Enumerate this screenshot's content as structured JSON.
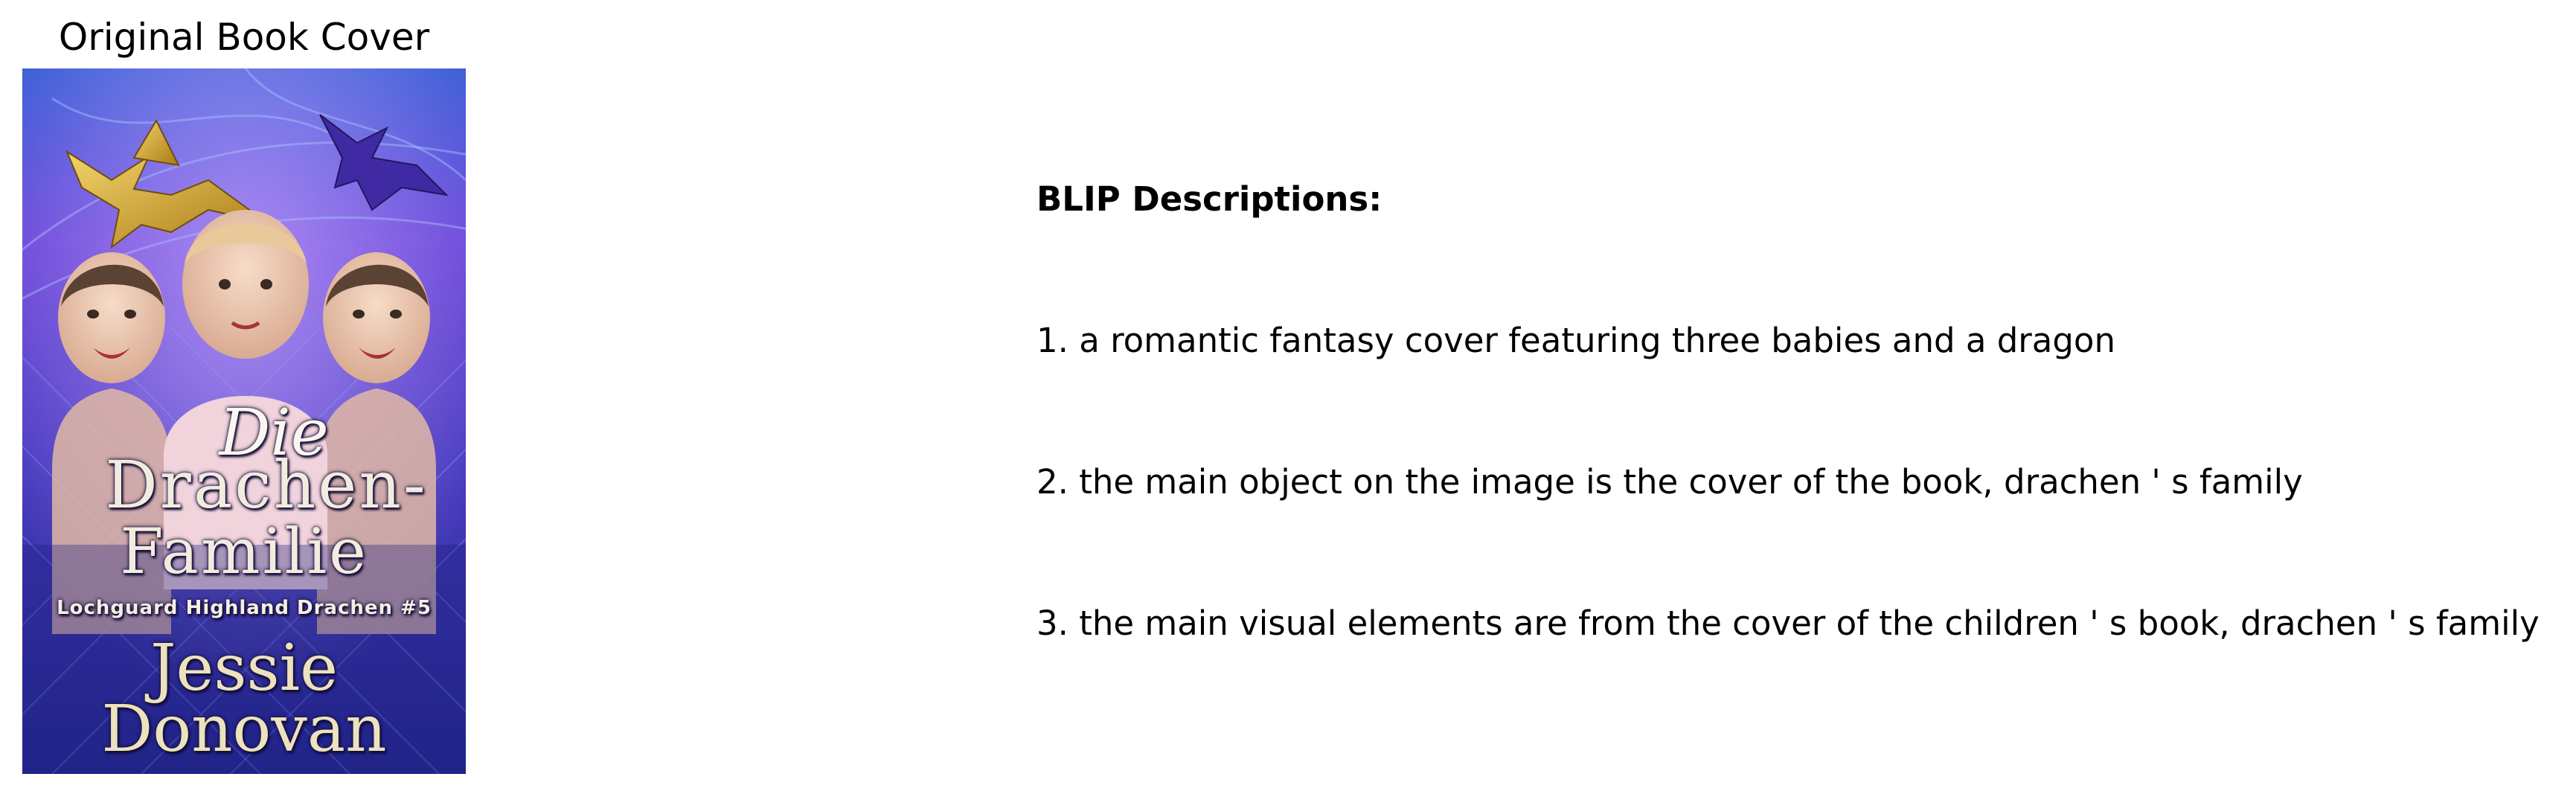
{
  "panel_title": "Original Book Cover",
  "cover": {
    "title_prefix": "Die",
    "title_line_1": "Drachen-",
    "title_line_2": "Familie",
    "series": "Lochguard Highland Drachen #5",
    "author_first": "Jessie",
    "author_last": "Donovan"
  },
  "descriptions": {
    "heading": "BLIP Descriptions:",
    "items": [
      "1. a romantic fantasy cover featuring three babies and a dragon",
      "2. the main object on the image is the cover of the book, drachen ' s family",
      "3. the main visual elements are from the cover of the children ' s book, drachen ' s family"
    ]
  },
  "colors": {
    "cover_background_top": "#5d3fcf",
    "cover_background_bottom": "#2a2a9a",
    "dragon_gold": "#c9a227",
    "dragon_purple": "#4b2aa8"
  }
}
